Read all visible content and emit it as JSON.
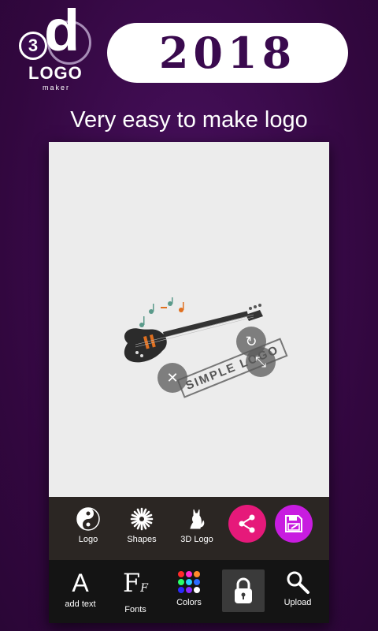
{
  "branding": {
    "badge_number": "3",
    "badge_letter": "d",
    "word": "LOGO",
    "sub": "maker"
  },
  "year": "2018",
  "tagline": "Very easy to make logo",
  "canvas": {
    "stamp_text": "SIMPLE LOGO",
    "handles": {
      "delete": "✕",
      "rotate": "↻",
      "resize": "⤡"
    }
  },
  "toolbar_top": [
    {
      "label": "Logo",
      "icon": "yin-yang-icon"
    },
    {
      "label": "Shapes",
      "icon": "flower-icon"
    },
    {
      "label": "3D Logo",
      "icon": "cat-icon"
    },
    {
      "label": "",
      "icon": "share-icon",
      "color": "#e6197a"
    },
    {
      "label": "",
      "icon": "save-icon",
      "color": "#c81ce0"
    }
  ],
  "toolbar_bottom": [
    {
      "label": "add text",
      "icon": "letter-a-icon",
      "glyph": "A"
    },
    {
      "label": "Fonts",
      "icon": "fonts-icon",
      "glyph": "F"
    },
    {
      "label": "Colors",
      "icon": "palette-icon"
    },
    {
      "label": "",
      "icon": "lock-icon"
    },
    {
      "label": "Upload",
      "icon": "magnifier-icon"
    }
  ],
  "colors": {
    "background": "#3a0a4e",
    "share": "#e6197a",
    "save": "#c81ce0"
  }
}
